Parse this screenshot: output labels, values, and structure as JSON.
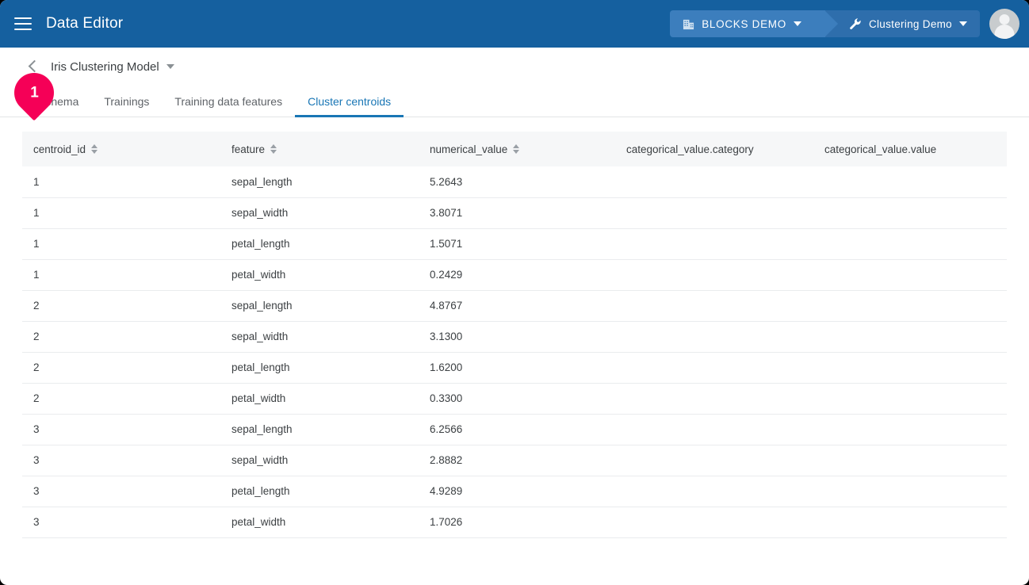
{
  "appbar": {
    "menu_icon": "hamburger-menu-icon",
    "title": "Data Editor",
    "org_chip": {
      "icon": "building-icon",
      "label": "BLOCKS DEMO",
      "caret": "chevron-down-icon"
    },
    "project_chip": {
      "icon": "wrench-icon",
      "label": "Clustering Demo",
      "caret": "chevron-down-icon"
    },
    "avatar": "user-avatar",
    "background_color": "#15609F",
    "org_chip_color": "#3C7EBD",
    "project_chip_color": "#2E6EAC"
  },
  "subheader": {
    "back_icon": "back-chevron-icon",
    "title": "Iris Clustering Model",
    "caret": "chevron-down-icon"
  },
  "tabs": [
    {
      "label": "Schema",
      "active": false
    },
    {
      "label": "Trainings",
      "active": false
    },
    {
      "label": "Training data features",
      "active": false
    },
    {
      "label": "Cluster centroids",
      "active": true
    }
  ],
  "active_tab_color": "#1976B5",
  "step_badge": {
    "number": "1",
    "color": "#F50057"
  },
  "table": {
    "columns": [
      {
        "label": "centroid_id",
        "sortable": true
      },
      {
        "label": "feature",
        "sortable": true
      },
      {
        "label": "numerical_value",
        "sortable": true
      },
      {
        "label": "categorical_value.category",
        "sortable": false
      },
      {
        "label": "categorical_value.value",
        "sortable": false
      }
    ],
    "rows": [
      {
        "centroid_id": "1",
        "feature": "sepal_length",
        "numerical_value": "5.2643",
        "categorical_value_category": "",
        "categorical_value_value": ""
      },
      {
        "centroid_id": "1",
        "feature": "sepal_width",
        "numerical_value": "3.8071",
        "categorical_value_category": "",
        "categorical_value_value": ""
      },
      {
        "centroid_id": "1",
        "feature": "petal_length",
        "numerical_value": "1.5071",
        "categorical_value_category": "",
        "categorical_value_value": ""
      },
      {
        "centroid_id": "1",
        "feature": "petal_width",
        "numerical_value": "0.2429",
        "categorical_value_category": "",
        "categorical_value_value": ""
      },
      {
        "centroid_id": "2",
        "feature": "sepal_length",
        "numerical_value": "4.8767",
        "categorical_value_category": "",
        "categorical_value_value": ""
      },
      {
        "centroid_id": "2",
        "feature": "sepal_width",
        "numerical_value": "3.1300",
        "categorical_value_category": "",
        "categorical_value_value": ""
      },
      {
        "centroid_id": "2",
        "feature": "petal_length",
        "numerical_value": "1.6200",
        "categorical_value_category": "",
        "categorical_value_value": ""
      },
      {
        "centroid_id": "2",
        "feature": "petal_width",
        "numerical_value": "0.3300",
        "categorical_value_category": "",
        "categorical_value_value": ""
      },
      {
        "centroid_id": "3",
        "feature": "sepal_length",
        "numerical_value": "6.2566",
        "categorical_value_category": "",
        "categorical_value_value": ""
      },
      {
        "centroid_id": "3",
        "feature": "sepal_width",
        "numerical_value": "2.8882",
        "categorical_value_category": "",
        "categorical_value_value": ""
      },
      {
        "centroid_id": "3",
        "feature": "petal_length",
        "numerical_value": "4.9289",
        "categorical_value_category": "",
        "categorical_value_value": ""
      },
      {
        "centroid_id": "3",
        "feature": "petal_width",
        "numerical_value": "1.7026",
        "categorical_value_category": "",
        "categorical_value_value": ""
      }
    ]
  }
}
